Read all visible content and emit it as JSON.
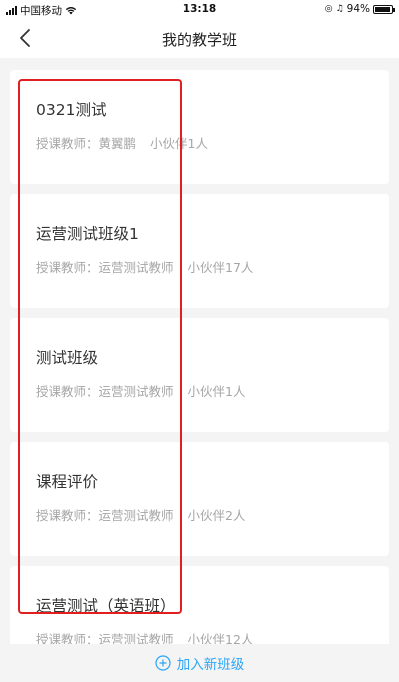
{
  "status_bar": {
    "carrier": "中国移动",
    "time": "13:18",
    "battery": "94%"
  },
  "nav": {
    "title": "我的教学班"
  },
  "classes": [
    {
      "name": "0321测试",
      "teacher": "授课教师：黄翼鹏",
      "members": "小伙伴1人"
    },
    {
      "name": "运营测试班级1",
      "teacher": "授课教师：运营测试教师",
      "members": "小伙伴17人"
    },
    {
      "name": "测试班级",
      "teacher": "授课教师：运营测试教师",
      "members": "小伙伴1人"
    },
    {
      "name": "课程评价",
      "teacher": "授课教师：运营测试教师",
      "members": "小伙伴2人"
    },
    {
      "name": "运营测试（英语班）",
      "teacher": "授课教师：运营测试教师",
      "members": "小伙伴12人"
    }
  ],
  "footer": {
    "join_label": "加入新班级"
  },
  "colors": {
    "accent": "#2ba5f7",
    "highlight": "#e02020",
    "meta_text": "#a6a6a6"
  }
}
